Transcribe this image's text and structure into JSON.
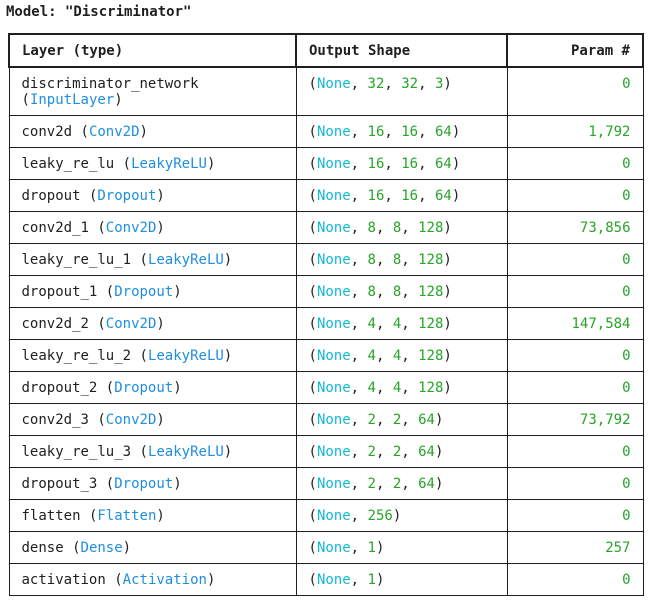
{
  "model_title": "Model: \"Discriminator\"",
  "columns": {
    "layer": "Layer (type)",
    "output": "Output Shape",
    "params": "Param #"
  },
  "colors": {
    "class_name": "#1e8fe0",
    "none_keyword": "#13b8d6",
    "numbers": "#28a428",
    "text": "#1f1f1f"
  },
  "layers": [
    {
      "name": "discriminator_network",
      "type": "InputLayer",
      "shape": [
        "None",
        "32",
        "32",
        "3"
      ],
      "params": "0"
    },
    {
      "name": "conv2d",
      "type": "Conv2D",
      "shape": [
        "None",
        "16",
        "16",
        "64"
      ],
      "params": "1,792"
    },
    {
      "name": "leaky_re_lu",
      "type": "LeakyReLU",
      "shape": [
        "None",
        "16",
        "16",
        "64"
      ],
      "params": "0"
    },
    {
      "name": "dropout",
      "type": "Dropout",
      "shape": [
        "None",
        "16",
        "16",
        "64"
      ],
      "params": "0"
    },
    {
      "name": "conv2d_1",
      "type": "Conv2D",
      "shape": [
        "None",
        "8",
        "8",
        "128"
      ],
      "params": "73,856"
    },
    {
      "name": "leaky_re_lu_1",
      "type": "LeakyReLU",
      "shape": [
        "None",
        "8",
        "8",
        "128"
      ],
      "params": "0"
    },
    {
      "name": "dropout_1",
      "type": "Dropout",
      "shape": [
        "None",
        "8",
        "8",
        "128"
      ],
      "params": "0"
    },
    {
      "name": "conv2d_2",
      "type": "Conv2D",
      "shape": [
        "None",
        "4",
        "4",
        "128"
      ],
      "params": "147,584"
    },
    {
      "name": "leaky_re_lu_2",
      "type": "LeakyReLU",
      "shape": [
        "None",
        "4",
        "4",
        "128"
      ],
      "params": "0"
    },
    {
      "name": "dropout_2",
      "type": "Dropout",
      "shape": [
        "None",
        "4",
        "4",
        "128"
      ],
      "params": "0"
    },
    {
      "name": "conv2d_3",
      "type": "Conv2D",
      "shape": [
        "None",
        "2",
        "2",
        "64"
      ],
      "params": "73,792"
    },
    {
      "name": "leaky_re_lu_3",
      "type": "LeakyReLU",
      "shape": [
        "None",
        "2",
        "2",
        "64"
      ],
      "params": "0"
    },
    {
      "name": "dropout_3",
      "type": "Dropout",
      "shape": [
        "None",
        "2",
        "2",
        "64"
      ],
      "params": "0"
    },
    {
      "name": "flatten",
      "type": "Flatten",
      "shape": [
        "None",
        "256"
      ],
      "params": "0"
    },
    {
      "name": "dense",
      "type": "Dense",
      "shape": [
        "None",
        "1"
      ],
      "params": "257"
    },
    {
      "name": "activation",
      "type": "Activation",
      "shape": [
        "None",
        "1"
      ],
      "params": "0"
    }
  ]
}
